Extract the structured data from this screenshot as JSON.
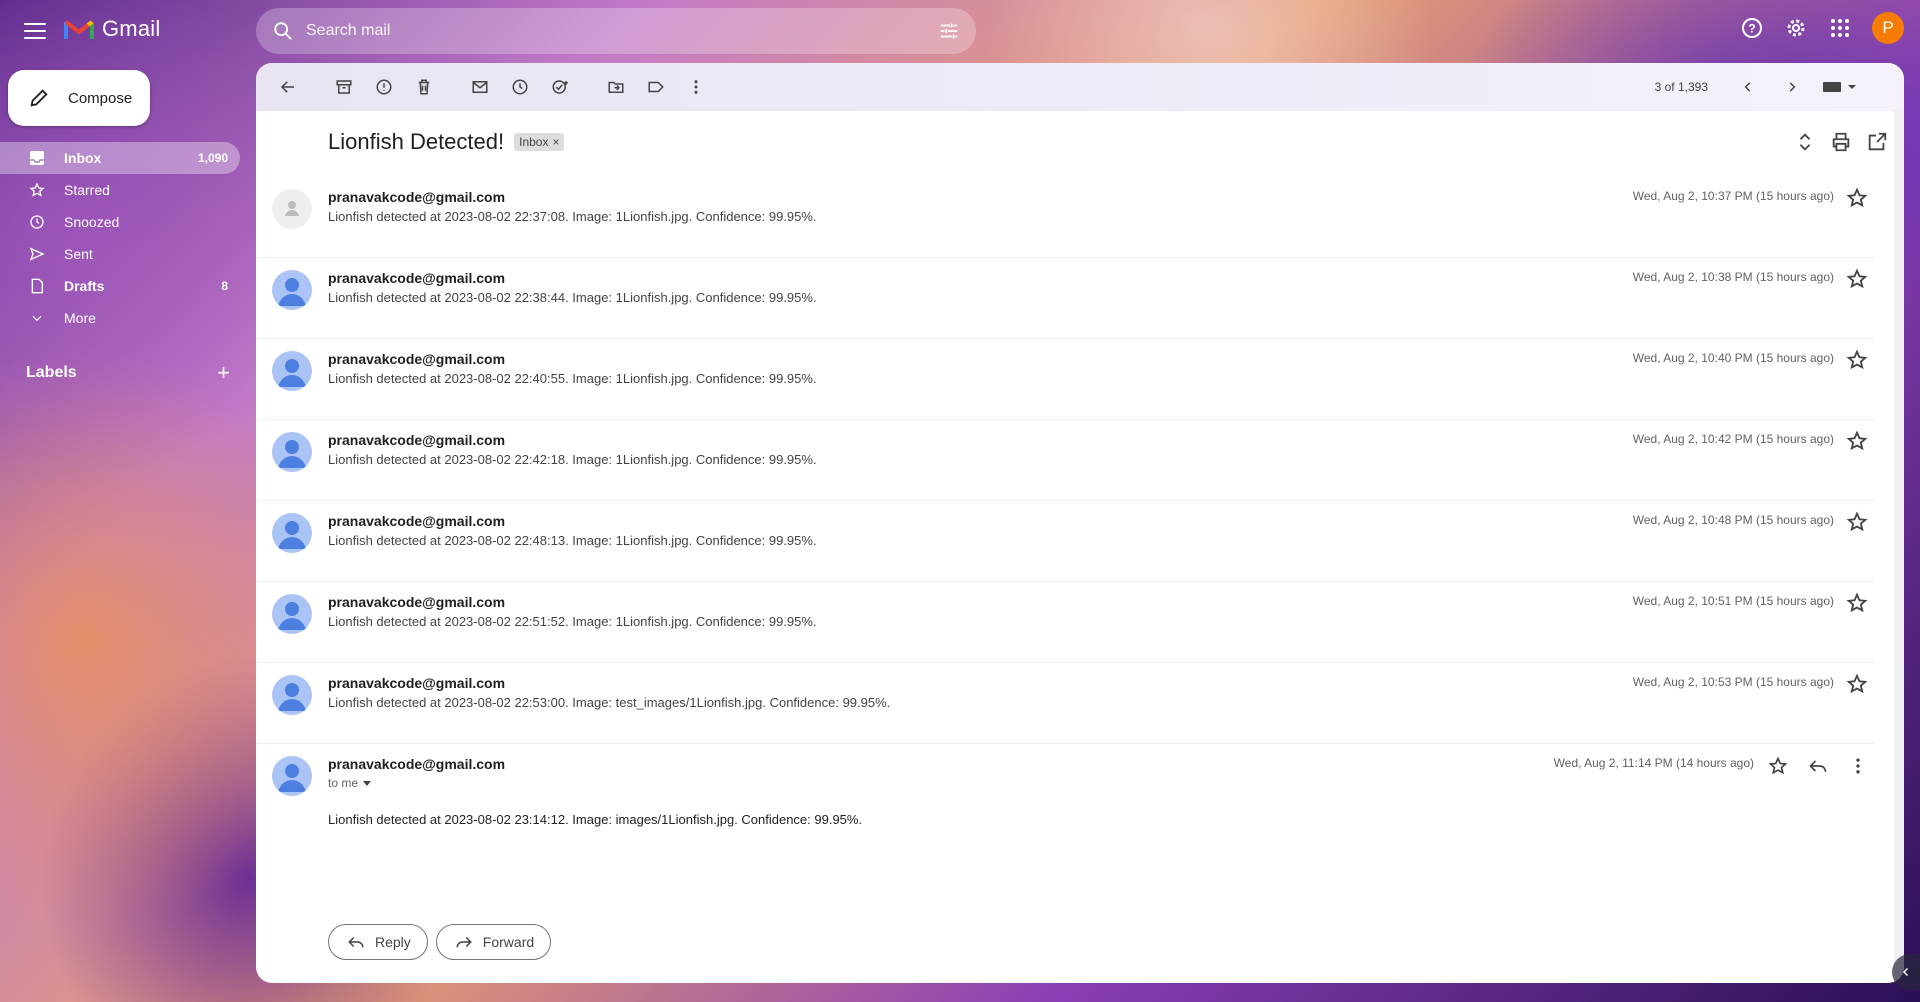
{
  "app": {
    "name": "Gmail"
  },
  "search": {
    "placeholder": "Search mail"
  },
  "account": {
    "initial": "P"
  },
  "compose": {
    "label": "Compose"
  },
  "nav": [
    {
      "label": "Inbox",
      "count": "1,090",
      "icon": "inbox-icon"
    },
    {
      "label": "Starred",
      "count": "",
      "icon": "star-icon"
    },
    {
      "label": "Snoozed",
      "count": "",
      "icon": "clock-icon"
    },
    {
      "label": "Sent",
      "count": "",
      "icon": "send-icon"
    },
    {
      "label": "Drafts",
      "count": "8",
      "icon": "draft-icon"
    },
    {
      "label": "More",
      "count": "",
      "icon": "chevron-down-icon"
    }
  ],
  "labels": {
    "title": "Labels"
  },
  "pager": {
    "text": "3 of 1,393"
  },
  "thread": {
    "subject": "Lionfish Detected!",
    "label_chip": "Inbox",
    "messages": [
      {
        "from": "pranavakcode@gmail.com",
        "snippet": "Lionfish detected at 2023-08-02 22:37:08. Image: 1Lionfish.jpg. Confidence: 99.95%.",
        "date": "Wed, Aug 2, 10:37 PM (15 hours ago)"
      },
      {
        "from": "pranavakcode@gmail.com",
        "snippet": "Lionfish detected at 2023-08-02 22:38:44. Image: 1Lionfish.jpg. Confidence: 99.95%.",
        "date": "Wed, Aug 2, 10:38 PM (15 hours ago)"
      },
      {
        "from": "pranavakcode@gmail.com",
        "snippet": "Lionfish detected at 2023-08-02 22:40:55. Image: 1Lionfish.jpg. Confidence: 99.95%.",
        "date": "Wed, Aug 2, 10:40 PM (15 hours ago)"
      },
      {
        "from": "pranavakcode@gmail.com",
        "snippet": "Lionfish detected at 2023-08-02 22:42:18. Image: 1Lionfish.jpg. Confidence: 99.95%.",
        "date": "Wed, Aug 2, 10:42 PM (15 hours ago)"
      },
      {
        "from": "pranavakcode@gmail.com",
        "snippet": "Lionfish detected at 2023-08-02 22:48:13. Image: 1Lionfish.jpg. Confidence: 99.95%.",
        "date": "Wed, Aug 2, 10:48 PM (15 hours ago)"
      },
      {
        "from": "pranavakcode@gmail.com",
        "snippet": "Lionfish detected at 2023-08-02 22:51:52. Image: 1Lionfish.jpg. Confidence: 99.95%.",
        "date": "Wed, Aug 2, 10:51 PM (15 hours ago)"
      },
      {
        "from": "pranavakcode@gmail.com",
        "snippet": "Lionfish detected at 2023-08-02 22:53:00. Image: test_images/1Lionfish.jpg. Confidence: 99.95%.",
        "date": "Wed, Aug 2, 10:53 PM (15 hours ago)"
      }
    ],
    "open_message": {
      "from": "pranavakcode@gmail.com",
      "to": "to me",
      "date": "Wed, Aug 2, 11:14 PM (14 hours ago)",
      "body": "Lionfish detected at 2023-08-02 23:14:12. Image: images/1Lionfish.jpg. Confidence: 99.95%."
    },
    "reply_label": "Reply",
    "forward_label": "Forward"
  },
  "colors": {
    "accent": "#f57c00",
    "avatar": "#aac4f5",
    "person": "#4c7fe0"
  }
}
